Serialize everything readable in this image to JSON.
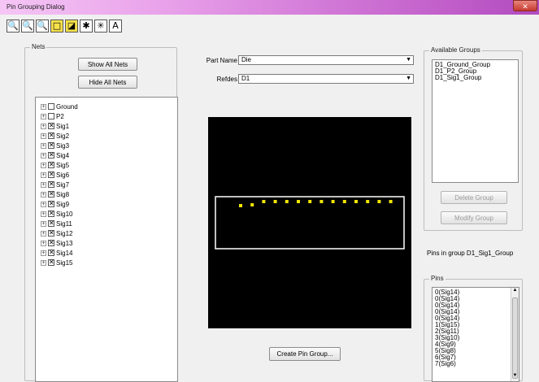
{
  "window": {
    "title": "Pin Grouping Dialog",
    "close_glyph": "✕"
  },
  "toolbar": {
    "buttons": [
      {
        "icon": "zoom-in-icon",
        "glyph": "🔍"
      },
      {
        "icon": "zoom-out-icon",
        "glyph": "🔍"
      },
      {
        "icon": "zoom-fit-icon",
        "glyph": "🔍"
      },
      {
        "icon": "select-rect-icon",
        "glyph": "□"
      },
      {
        "icon": "select-pins-icon",
        "glyph": "◪"
      },
      {
        "icon": "asterisk-icon",
        "glyph": "✱"
      },
      {
        "icon": "asterisk-bold-icon",
        "glyph": "✳"
      },
      {
        "icon": "text-icon",
        "glyph": "A"
      }
    ]
  },
  "nets": {
    "label": "Nets",
    "show_all": "Show All Nets",
    "hide_all": "Hide All Nets",
    "items": [
      {
        "name": "Ground",
        "checked": false
      },
      {
        "name": "P2",
        "checked": false
      },
      {
        "name": "Sig1",
        "checked": true
      },
      {
        "name": "Sig2",
        "checked": true
      },
      {
        "name": "Sig3",
        "checked": true
      },
      {
        "name": "Sig4",
        "checked": true
      },
      {
        "name": "Sig5",
        "checked": true
      },
      {
        "name": "Sig6",
        "checked": true
      },
      {
        "name": "Sig7",
        "checked": true
      },
      {
        "name": "Sig8",
        "checked": true
      },
      {
        "name": "Sig9",
        "checked": true
      },
      {
        "name": "Sig10",
        "checked": true
      },
      {
        "name": "Sig11",
        "checked": true
      },
      {
        "name": "Sig12",
        "checked": true
      },
      {
        "name": "Sig13",
        "checked": true
      },
      {
        "name": "Sig14",
        "checked": true
      },
      {
        "name": "Sig15",
        "checked": true
      }
    ],
    "plus_glyph": "+",
    "check_glyph": "✕"
  },
  "part": {
    "part_name_label": "Part Name",
    "part_name_value": "Die",
    "refdes_label": "Refdes",
    "refdes_value": "D1",
    "arrow_glyph": "▼"
  },
  "canvas": {
    "background": "#000000",
    "outline_color": "#ffffff",
    "pin_color": "#f2e600",
    "pin_count": 14
  },
  "create_button": "Create Pin Group...",
  "groups": {
    "label": "Available Groups",
    "items": [
      "D1_Ground_Group",
      "D1_P2_Group",
      "D1_Sig1_Group"
    ],
    "delete": "Delete Group",
    "modify": "Modify Group"
  },
  "pins_in_group": "Pins in group D1_Sig1_Group",
  "pins": {
    "label": "Pins",
    "items": [
      "0(Sig14)",
      "0(Sig14)",
      "0(Sig14)",
      "0(Sig14)",
      "0(Sig14)",
      "1(Sig15)",
      "2(Sig11)",
      "3(Sig10)",
      "4(Sig9)",
      "5(Sig8)",
      "6(Sig7)",
      "7(Sig6)"
    ],
    "up_glyph": "▲",
    "down_glyph": "▼"
  }
}
